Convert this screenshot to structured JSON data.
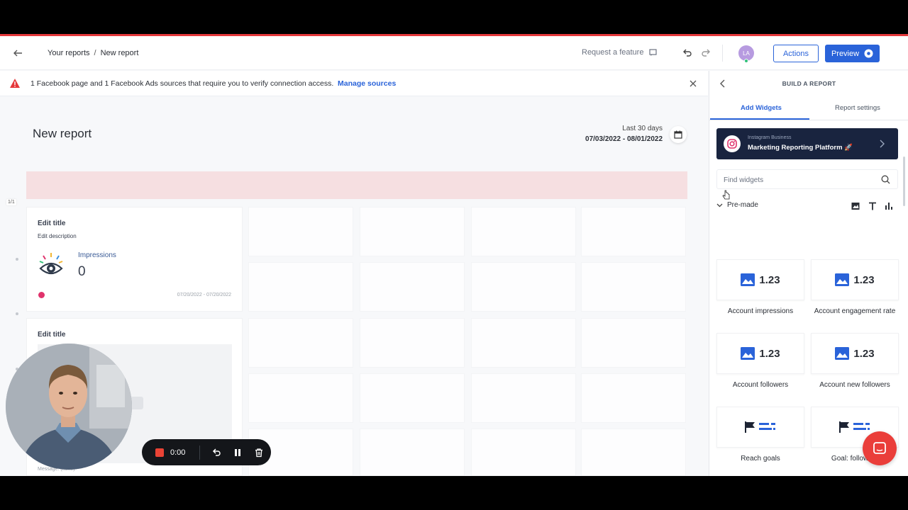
{
  "header": {
    "breadcrumb": [
      "Your reports",
      "New report"
    ],
    "request_feature": "Request a feature",
    "avatar_initials": "LA",
    "actions_label": "Actions",
    "preview_label": "Preview"
  },
  "warning": {
    "message": "1 Facebook page and 1 Facebook Ads sources that require you to verify connection access.",
    "link": "Manage sources"
  },
  "report": {
    "title": "New report",
    "date_label": "Last 30 days",
    "date_range": "07/03/2022 - 08/01/2022",
    "page_indicator": "1/1"
  },
  "widgets": [
    {
      "title": "Edit title",
      "description": "Edit description",
      "metric": "Impressions",
      "value": "0",
      "date_range": "07/20/2022 - 07/20/2022"
    },
    {
      "title": "Edit title",
      "footer": "Message: (none)"
    }
  ],
  "panel": {
    "heading": "BUILD A REPORT",
    "tabs": [
      "Add Widgets",
      "Report settings"
    ],
    "source": {
      "type": "Instagram Business",
      "name": "Marketing Reporting Platform 🚀"
    },
    "search_placeholder": "Find widgets",
    "section": "Pre-made",
    "tiles": [
      {
        "label": "Account impressions",
        "preview": "1.23",
        "kind": "number"
      },
      {
        "label": "Account engagement rate",
        "preview": "1.23",
        "kind": "number"
      },
      {
        "label": "Account followers",
        "preview": "1.23",
        "kind": "number"
      },
      {
        "label": "Account new followers",
        "preview": "1.23",
        "kind": "number"
      },
      {
        "label": "Reach goals",
        "preview": "",
        "kind": "goal"
      },
      {
        "label": "Goal: followers",
        "preview": "",
        "kind": "goal"
      }
    ]
  },
  "recorder": {
    "time": "0:00"
  },
  "colors": {
    "accent": "#2a63d9",
    "warning_red": "#e5383b",
    "source_card": "#19243f",
    "pink_bar": "#f6dfe1",
    "chat_bubble": "#ea3e3a"
  }
}
